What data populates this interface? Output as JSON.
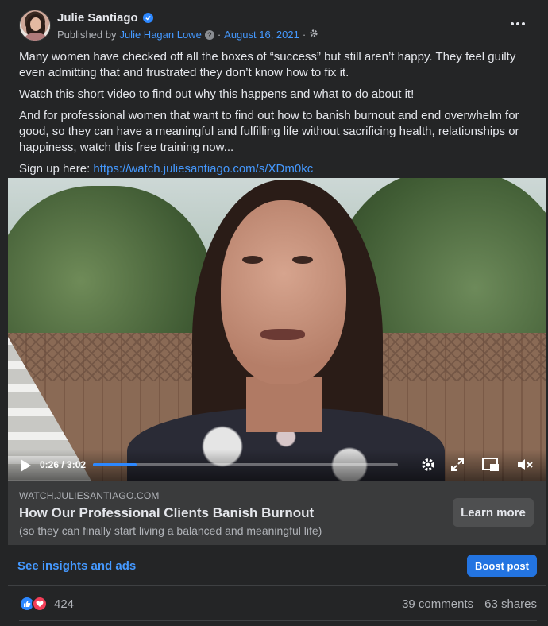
{
  "post": {
    "author": "Julie Santiago",
    "published_by_prefix": "Published by",
    "publisher": "Julie Hagan Lowe",
    "date": "August 16, 2021",
    "icons": [
      "verified-badge-icon",
      "question-icon",
      "settings-gear-icon",
      "more-dots-icon"
    ]
  },
  "body": {
    "p1": "Many women have checked off all the boxes of “success” but still aren’t happy. They feel guilty even admitting that and frustrated they don’t know how to fix it.",
    "p2": "Watch this short video to find out why this happens and what to do about it!",
    "p3": "And for professional women that want to find out how to banish burnout and end overwhelm for good, so they can have a meaningful and fulfilling life without sacrificing health, relationships or happiness, watch this free training now...",
    "signup_prefix": "Sign up here:",
    "signup_link": "https://watch.juliesantiago.com/s/XDm0kc"
  },
  "video": {
    "time": "0:26 / 3:02",
    "progress_fraction": 0.143,
    "icons": [
      "play-icon",
      "settings-icon",
      "fullscreen-icon",
      "pip-icon",
      "mute-icon"
    ]
  },
  "link_preview": {
    "domain": "WATCH.JULIESANTIAGO.COM",
    "title": "How Our Professional Clients Banish Burnout",
    "subtitle": "(so they can finally start living a balanced and meaningful life)",
    "cta": "Learn more"
  },
  "insights": {
    "link_label": "See insights and ads",
    "boost_label": "Boost post"
  },
  "engagement": {
    "reaction_count": "424",
    "comments": "39 comments",
    "shares": "63 shares"
  },
  "colors": {
    "background": "#242526",
    "link": "#4599ff",
    "boost": "#2374e1",
    "like": "#2d88ff",
    "love": "#f33e58"
  }
}
